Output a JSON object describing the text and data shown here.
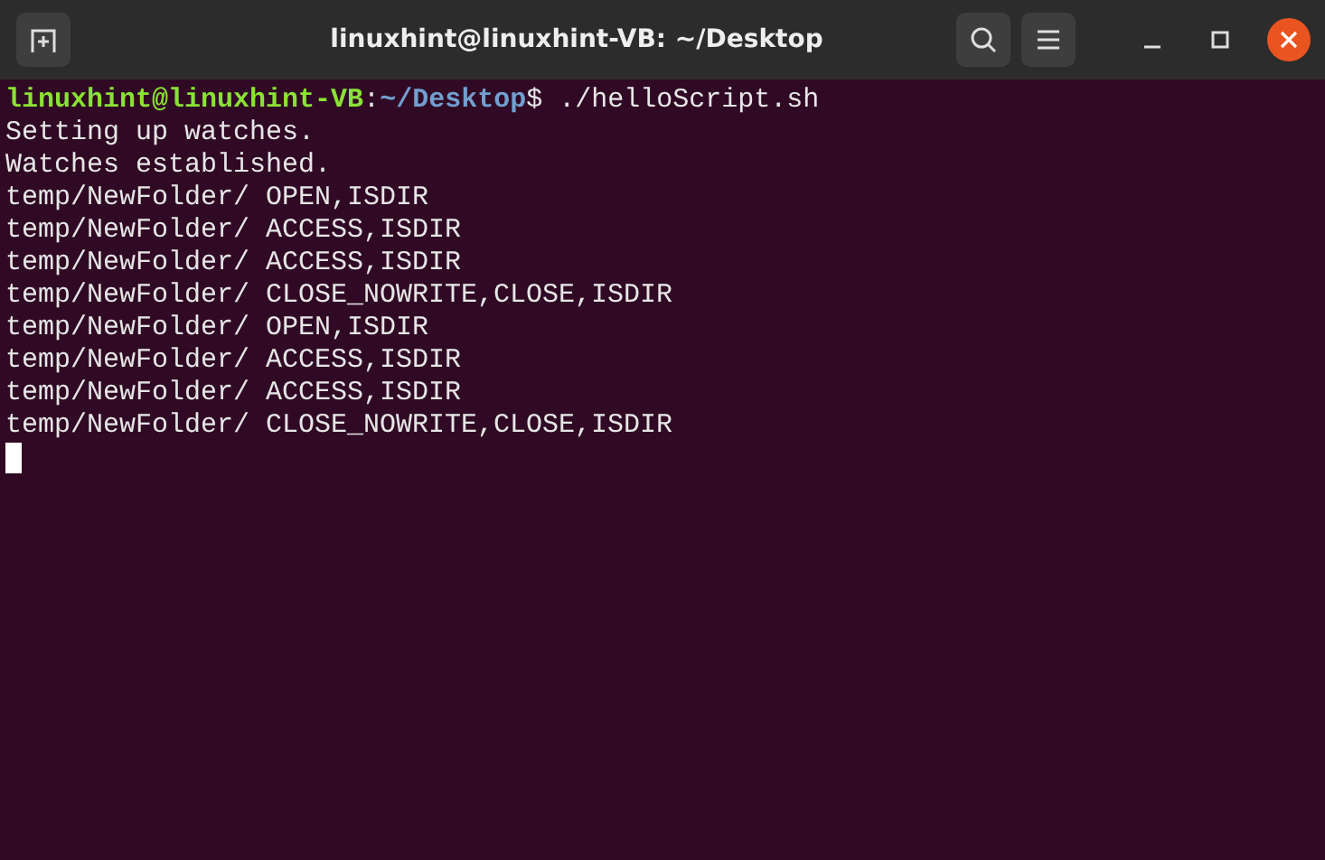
{
  "window": {
    "title": "linuxhint@linuxhint-VB: ~/Desktop"
  },
  "prompt": {
    "user": "linuxhint@linuxhint-VB",
    "separator": ":",
    "path": "~/Desktop",
    "symbol": "$",
    "command": "./helloScript.sh"
  },
  "output": [
    "Setting up watches.",
    "Watches established.",
    "temp/NewFolder/ OPEN,ISDIR",
    "temp/NewFolder/ ACCESS,ISDIR",
    "temp/NewFolder/ ACCESS,ISDIR",
    "temp/NewFolder/ CLOSE_NOWRITE,CLOSE,ISDIR",
    "temp/NewFolder/ OPEN,ISDIR",
    "temp/NewFolder/ ACCESS,ISDIR",
    "temp/NewFolder/ ACCESS,ISDIR",
    "temp/NewFolder/ CLOSE_NOWRITE,CLOSE,ISDIR"
  ],
  "cursor": {
    "visible": true
  }
}
